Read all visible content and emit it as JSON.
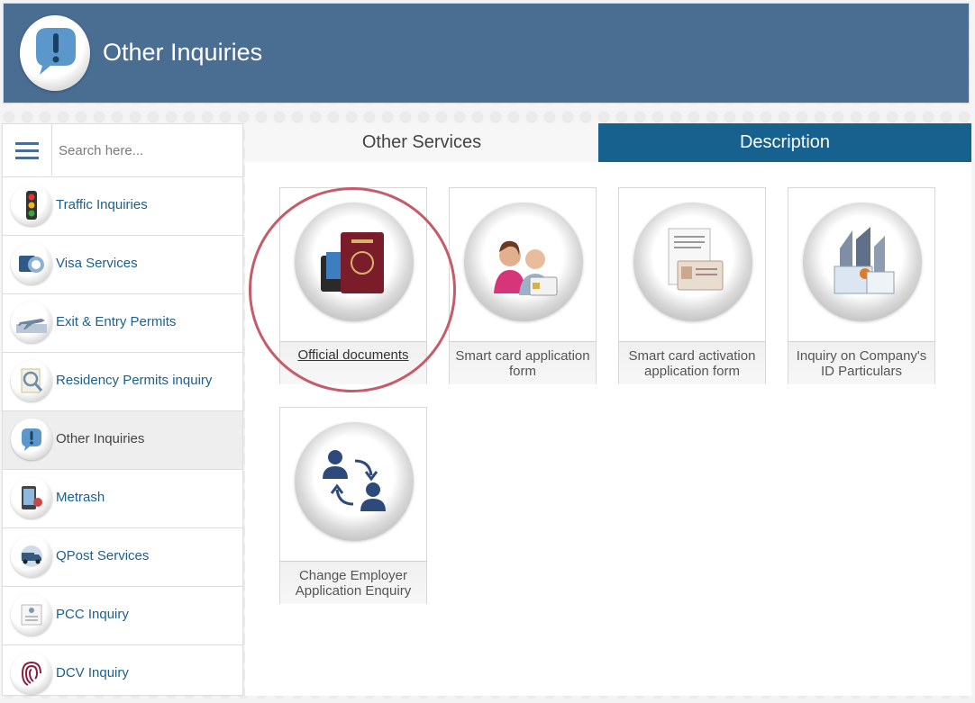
{
  "header": {
    "title": "Other Inquiries",
    "icon": "exclamation-bubble-icon"
  },
  "search": {
    "placeholder": "Search here..."
  },
  "sidebar": {
    "items": [
      {
        "label": "Traffic Inquiries",
        "icon": "traffic-light-icon"
      },
      {
        "label": "Visa Services",
        "icon": "passport-stamp-icon"
      },
      {
        "label": "Exit & Entry Permits",
        "icon": "airplane-icon"
      },
      {
        "label": "Residency Permits inquiry",
        "icon": "magnifier-document-icon"
      },
      {
        "label": "Other Inquiries",
        "icon": "exclamation-bubble-icon",
        "active": true
      },
      {
        "label": "Metrash",
        "icon": "phone-icon"
      },
      {
        "label": "QPost Services",
        "icon": "delivery-truck-icon"
      },
      {
        "label": "PCC Inquiry",
        "icon": "certificate-icon"
      },
      {
        "label": "DCV Inquiry",
        "icon": "fingerprint-icon"
      }
    ]
  },
  "tabs": {
    "other_services": "Other Services",
    "description": "Description"
  },
  "cards": [
    {
      "label": "Official documents",
      "icon": "passport-icon"
    },
    {
      "label": "Smart card application form",
      "icon": "people-card-icon"
    },
    {
      "label": "Smart card activation application form",
      "icon": "id-documents-icon"
    },
    {
      "label": "Inquiry on Company's ID Particulars",
      "icon": "company-building-icon"
    },
    {
      "label": "Change Employer Application Enquiry",
      "icon": "swap-employer-icon"
    }
  ],
  "colors": {
    "header_bg": "#4a6d92",
    "active_tab_bg": "#17618f",
    "link_text": "#1b5f8c",
    "highlight": "#c65b6a"
  }
}
